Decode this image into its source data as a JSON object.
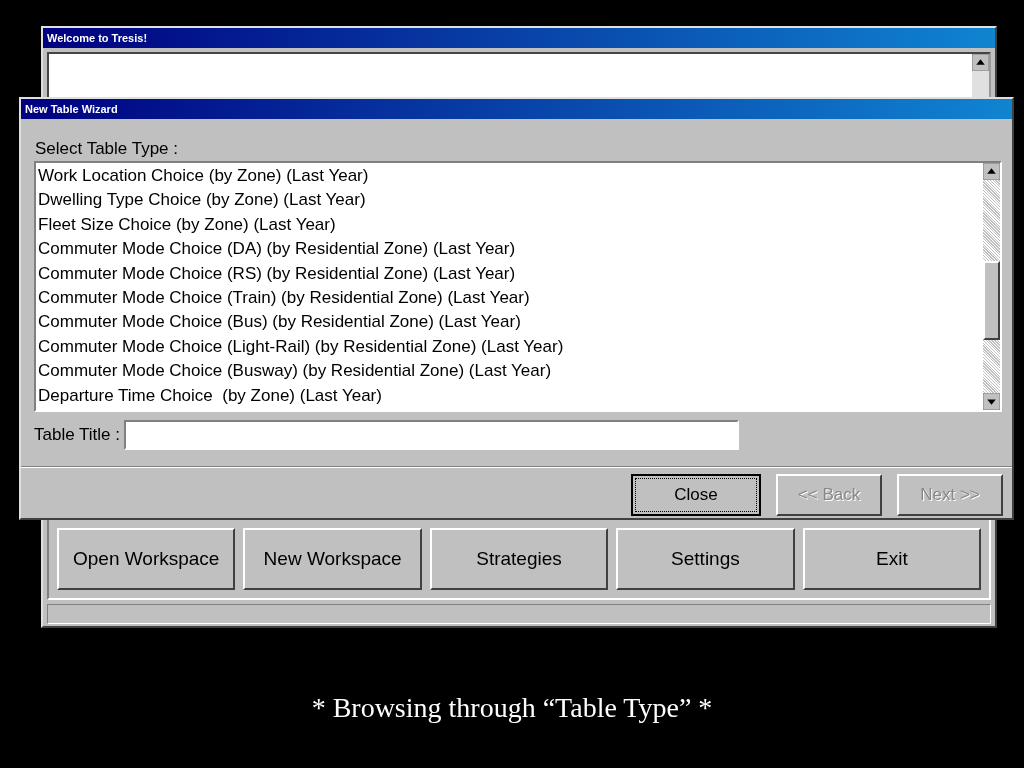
{
  "main_window": {
    "title": "Welcome to Tresis!",
    "buttons": [
      {
        "label": "Open Workspace"
      },
      {
        "label": "New Workspace"
      },
      {
        "label": "Strategies"
      },
      {
        "label": "Settings"
      },
      {
        "label": "Exit"
      }
    ]
  },
  "wizard": {
    "title": "New Table Wizard",
    "list_label": "Select Table Type :",
    "table_types": [
      "Work Location Choice (by Zone) (Last Year)",
      "Dwelling Type Choice (by Zone) (Last Year)",
      "Fleet Size Choice (by Zone) (Last Year)",
      "Commuter Mode Choice (DA) (by Residential Zone) (Last Year)",
      "Commuter Mode Choice (RS) (by Residential Zone) (Last Year)",
      "Commuter Mode Choice (Train) (by Residential Zone) (Last Year)",
      "Commuter Mode Choice (Bus) (by Residential Zone) (Last Year)",
      "Commuter Mode Choice (Light-Rail) (by Residential Zone) (Last Year)",
      "Commuter Mode Choice (Busway) (by Residential Zone) (Last Year)",
      "Departure Time Choice  (by Zone) (Last Year)"
    ],
    "title_label": "Table Title :",
    "buttons": [
      {
        "label": "Close",
        "disabled": false,
        "focused": true
      },
      {
        "label": "<< Back",
        "disabled": true,
        "focused": false
      },
      {
        "label": "Next >>",
        "disabled": true,
        "focused": false
      }
    ]
  },
  "caption": "* Browsing through “Table Type” *"
}
